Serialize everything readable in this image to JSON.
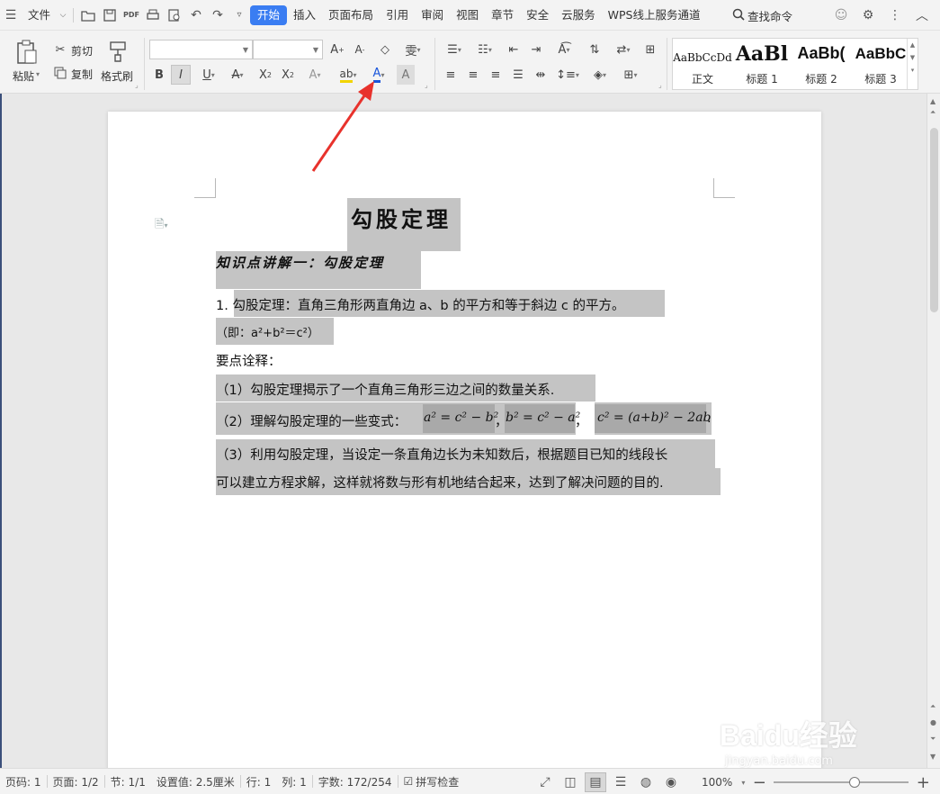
{
  "menu": {
    "file": "文件",
    "tabs": [
      "开始",
      "插入",
      "页面布局",
      "引用",
      "审阅",
      "视图",
      "章节",
      "安全",
      "云服务",
      "WPS线上服务通道"
    ],
    "active_tab": "开始",
    "search": "查找命令"
  },
  "ribbon": {
    "paste": "粘贴",
    "cut": "剪切",
    "copy": "复制",
    "format_painter": "格式刷",
    "styles": [
      {
        "sample": "AaBbCcDd",
        "name": "正文"
      },
      {
        "sample": "AaBl",
        "name": "标题 1"
      },
      {
        "sample": "AaBb(",
        "name": "标题 2"
      },
      {
        "sample": "AaBbC",
        "name": "标题 3"
      }
    ],
    "font_color_accent": "#1a56db"
  },
  "document": {
    "title": "勾股定理",
    "subtitle": "知识点讲解一：勾股定理",
    "p1": "1. 勾股定理：直角三角形两直角边 a、b 的平方和等于斜边 c 的平方。",
    "p2": "（即：a²+b²＝c²）",
    "p3": "要点诠释：",
    "p4": "（1）勾股定理揭示了一个直角三角形三边之间的数量关系.",
    "p5_prefix": "（2）理解勾股定理的一些变式：",
    "formula1": "a² = c² − b²",
    "formula2": "b² = c² − a²",
    "formula3": "c² = (a+b)² − 2ab",
    "comma": "，",
    "period": ".",
    "p6_line1": "（3）利用勾股定理，当设定一条直角边长为未知数后，根据题目已知的线段长",
    "p6_line2": "可以建立方程求解，这样就将数与形有机地结合起来，达到了解决问题的目的."
  },
  "status": {
    "page": "页码: 1",
    "pages": "页面: 1/2",
    "section": "节: 1/1",
    "setting": "设置值: 2.5厘米",
    "row": "行: 1",
    "col": "列: 1",
    "words": "字数: 172/254",
    "spellcheck": "拼写检查",
    "zoom": "100%"
  },
  "watermark": {
    "brand": "Baidu经验",
    "url": "jingyan.baidu.com"
  },
  "colors": {
    "active_tab": "#3a7df2",
    "selection": "#c4c4c4",
    "arrow": "#e8322c"
  }
}
